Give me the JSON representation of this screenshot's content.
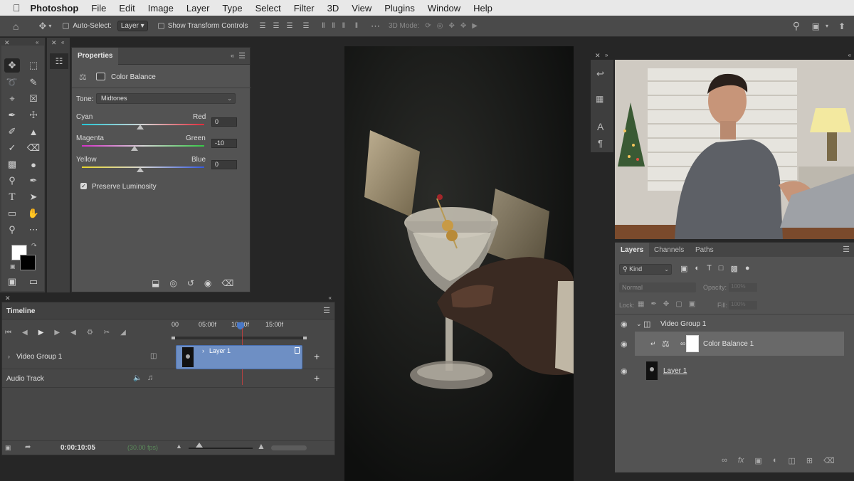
{
  "menubar": {
    "app": "Photoshop",
    "items": [
      "File",
      "Edit",
      "Image",
      "Layer",
      "Type",
      "Select",
      "Filter",
      "3D",
      "View",
      "Plugins",
      "Window",
      "Help"
    ]
  },
  "options": {
    "auto_select_label": "Auto-Select:",
    "auto_select_value": "Layer",
    "show_transform_label": "Show Transform Controls",
    "mode_3d_label": "3D Mode:"
  },
  "properties": {
    "tab": "Properties",
    "adjustment_name": "Color Balance",
    "tone_label": "Tone:",
    "tone_value": "Midtones",
    "sliders": [
      {
        "left": "Cyan",
        "right": "Red",
        "value": "0",
        "level": 0.0
      },
      {
        "left": "Magenta",
        "right": "Green",
        "value": "-10",
        "level": -0.1
      },
      {
        "left": "Yellow",
        "right": "Blue",
        "value": "0",
        "level": 0.0
      }
    ],
    "preserve_luminosity_label": "Preserve Luminosity",
    "preserve_luminosity_checked": true
  },
  "timeline": {
    "title": "Timeline",
    "ruler": [
      "00",
      "05:00f",
      "10:00f",
      "15:00f"
    ],
    "tracks": {
      "video_group": "Video Group 1",
      "clip": "Layer 1",
      "audio": "Audio Track"
    },
    "current_time": "0:00:10:05",
    "fps": "(30.00 fps)"
  },
  "layers": {
    "tabs": [
      "Layers",
      "Channels",
      "Paths"
    ],
    "filter_kind": "Kind",
    "blend_mode": "Normal",
    "opacity_label": "Opacity:",
    "opacity_value": "100%",
    "lock_label": "Lock:",
    "fill_label": "Fill:",
    "fill_value": "100%",
    "rows": [
      {
        "name": "Video Group 1",
        "type": "group"
      },
      {
        "name": "Color Balance 1",
        "type": "adjustment"
      },
      {
        "name": "Layer 1",
        "type": "video"
      }
    ]
  },
  "colors": {
    "accent_blue": "#4a78c6",
    "playhead": "#d04040"
  }
}
